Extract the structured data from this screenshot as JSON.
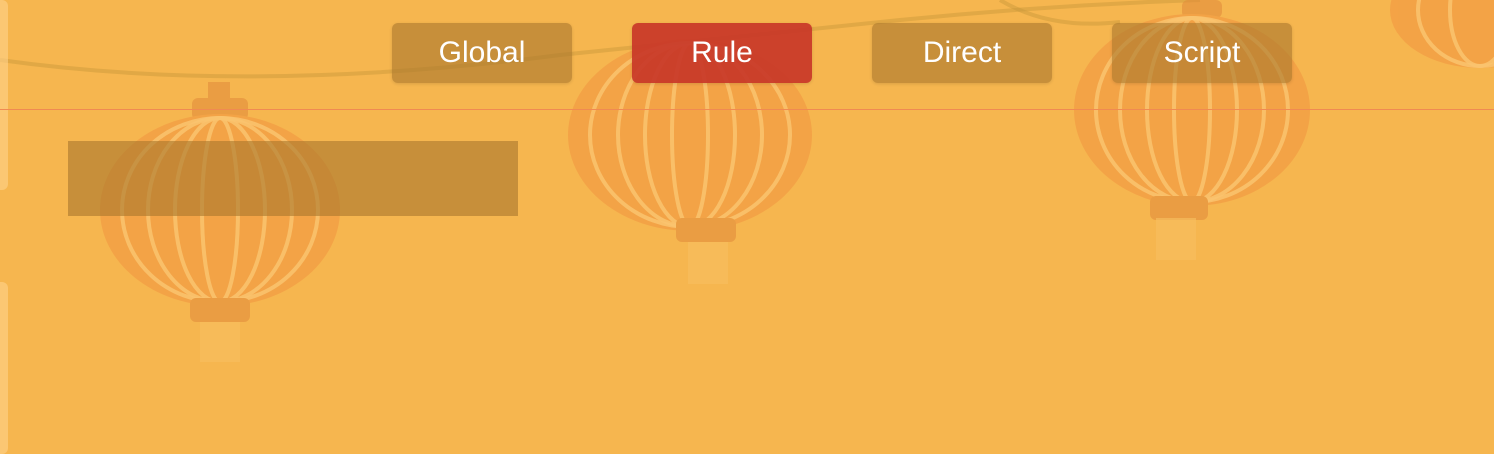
{
  "modes": [
    {
      "label": "Global",
      "active": false
    },
    {
      "label": "Rule",
      "active": true
    },
    {
      "label": "Direct",
      "active": false
    },
    {
      "label": "Script",
      "active": false
    }
  ],
  "colors": {
    "background": "#f6b64f",
    "button": "#b88a3a",
    "button_active": "#c83728",
    "divider": "#f08a52",
    "lantern": "#f0a04a"
  }
}
